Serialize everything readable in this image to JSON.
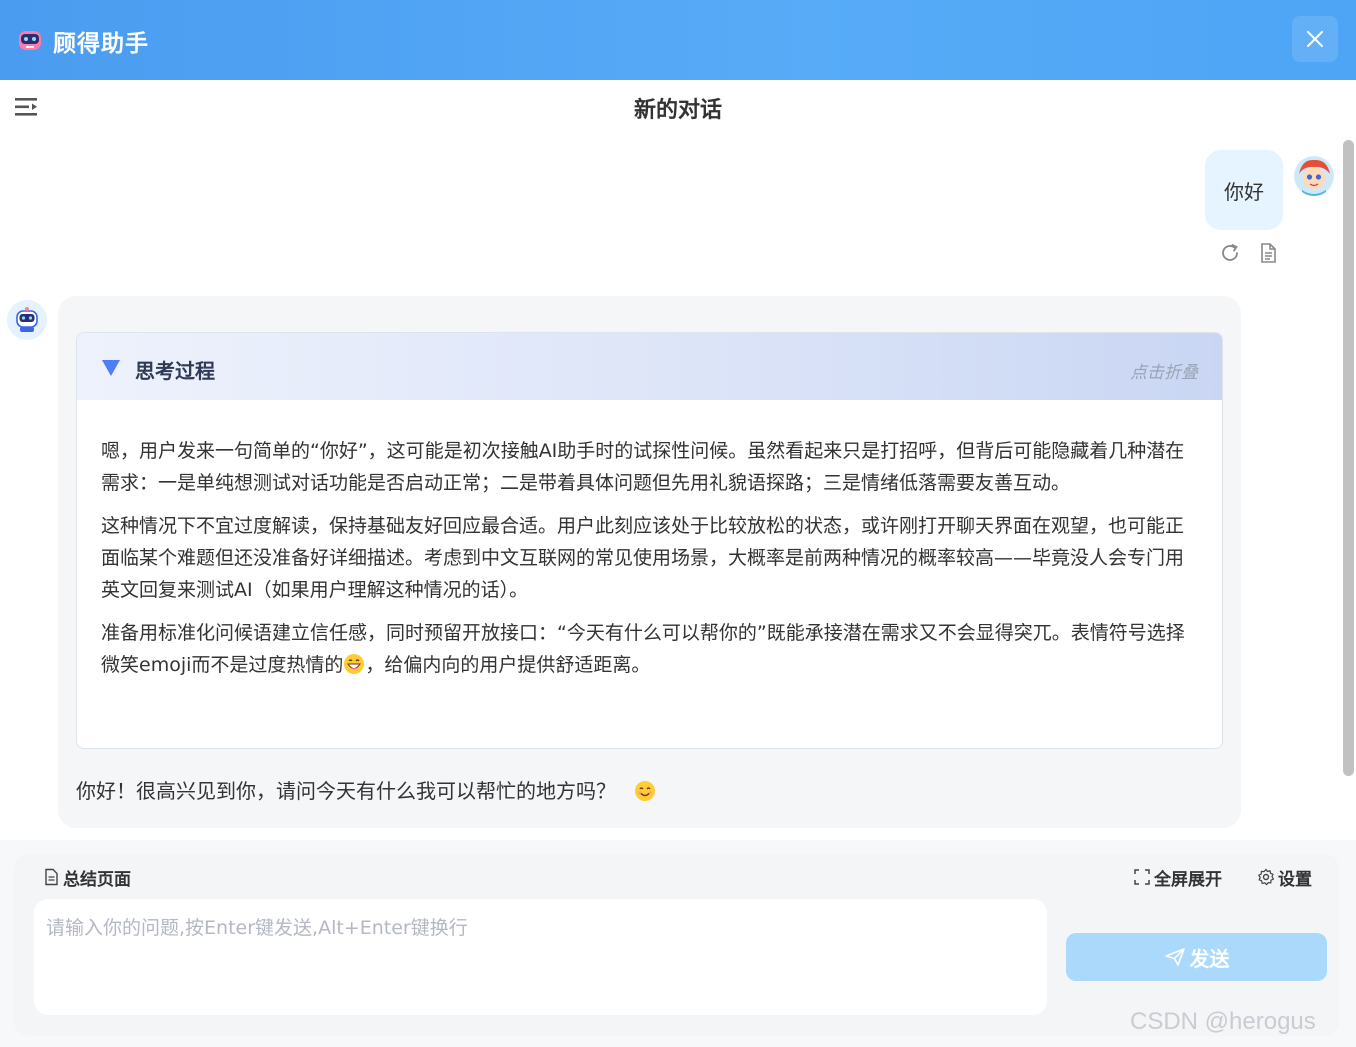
{
  "app": {
    "title": "顾得助手"
  },
  "conversation": {
    "title": "新的对话"
  },
  "messages": {
    "user": {
      "text": "你好"
    },
    "thinking": {
      "title": "思考过程",
      "collapse_hint": "点击折叠",
      "paragraph_1": "嗯，用户发来一句简单的“你好”，这可能是初次接触AI助手时的试探性问候。虽然看起来只是打招呼，但背后可能隐藏着几种潜在需求：一是单纯想测试对话功能是否启动正常；二是带着具体问题但先用礼貌语探路；三是情绪低落需要友善互动。",
      "paragraph_2": "这种情况下不宜过度解读，保持基础友好回应最合适。用户此刻应该处于比较放松的状态，或许刚打开聊天界面在观望，也可能正面临某个难题但还没准备好详细描述。考虑到中文互联网的常见使用场景，大概率是前两种情况的概率较高——毕竟没人会专门用英文回复来测试AI（如果用户理解这种情况的话）。",
      "paragraph_3_before": "准备用标准化问候语建立信任感，同时预留开放接口：“今天有什么可以帮你的”既能承接潜在需求又不会显得突兀。表情符号选择微笑emoji而不是过度热情的",
      "paragraph_3_after": "，给偏内向的用户提供舒适距离。"
    },
    "answer": {
      "text": "你好！很高兴见到你，请问今天有什么我可以帮忙的地方吗？"
    }
  },
  "toolbar": {
    "summarize_label": "总结页面",
    "fullscreen_label": "全屏展开",
    "settings_label": "设置"
  },
  "input": {
    "placeholder": "请输入你的问题,按Enter键发送,Alt+Enter键换行",
    "value": ""
  },
  "send": {
    "label": "发送"
  },
  "watermark": "CSDN @herogus",
  "colors": {
    "header_gradient_start": "#4a9cf0",
    "accent": "#4f7cf7",
    "user_bubble": "#e6f4ff",
    "send_button": "#aad9fb"
  },
  "icons": [
    "robot-logo-icon",
    "close-icon",
    "menu-collapse-icon",
    "refresh-icon",
    "document-icon",
    "triangle-down-icon",
    "grin-emoji-icon",
    "smile-emoji-icon",
    "file-icon",
    "fullscreen-icon",
    "gear-icon",
    "send-icon"
  ]
}
